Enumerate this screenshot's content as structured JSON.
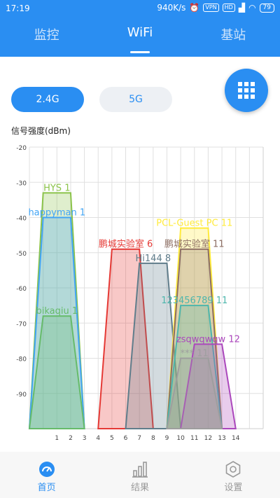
{
  "status_bar": {
    "time": "17:19",
    "speed": "940K/s",
    "vpn": "VPN",
    "signal_label": "HD",
    "battery": "79"
  },
  "top_tabs": [
    {
      "label": "监控",
      "active": false
    },
    {
      "label": "WiFi",
      "active": true
    },
    {
      "label": "基站",
      "active": false
    }
  ],
  "band_buttons": {
    "band_24": "2.4G",
    "band_5": "5G",
    "selected": "2.4G"
  },
  "colors": {
    "primary": "#2a8ef2",
    "inactive_button": "#edf0f4"
  },
  "chart_data": {
    "type": "area",
    "ylabel": "信号强度(dBm)",
    "ylim": [
      -100,
      -20
    ],
    "yticks": [
      -20,
      -30,
      -40,
      -50,
      -60,
      -70,
      -80,
      -90
    ],
    "xlim": [
      -1,
      16
    ],
    "xticks": [
      1,
      2,
      3,
      4,
      5,
      6,
      7,
      8,
      9,
      10,
      11,
      12,
      13,
      14
    ],
    "grid": true,
    "series": [
      {
        "name": "HYS 1",
        "channel": 1,
        "signal": -33,
        "color": "#8bc34a"
      },
      {
        "name": "happyman 1",
        "channel": 1,
        "signal": -40,
        "color": "#42a5f5"
      },
      {
        "name": "bikaqiu 1",
        "channel": 1,
        "signal": -68,
        "color": "#66bb6a"
      },
      {
        "name": "鹏城实验室 6",
        "channel": 6,
        "signal": -49,
        "color": "#e53935"
      },
      {
        "name": "Hi144 8",
        "channel": 8,
        "signal": -53,
        "color": "#607d8b"
      },
      {
        "name": "PCL-Guest PC 11",
        "channel": 11,
        "signal": -43,
        "color": "#ffeb3b"
      },
      {
        "name": "鹏城实验室 11",
        "channel": 11,
        "signal": -49,
        "color": "#8d6e63"
      },
      {
        "name": "123456789 11",
        "channel": 11,
        "signal": -65,
        "color": "#4db6ac"
      },
      {
        "name": "zsqwqwqw 12",
        "channel": 12,
        "signal": -76,
        "color": "#ab47bc"
      },
      {
        "name": "*** 11",
        "channel": 11,
        "signal": -80,
        "color": "#9e9e9e"
      }
    ]
  },
  "bottom_nav": [
    {
      "label": "首页",
      "icon": "gauge-icon",
      "active": true
    },
    {
      "label": "结果",
      "icon": "bar-chart-icon",
      "active": false
    },
    {
      "label": "设置",
      "icon": "settings-icon",
      "active": false
    }
  ]
}
